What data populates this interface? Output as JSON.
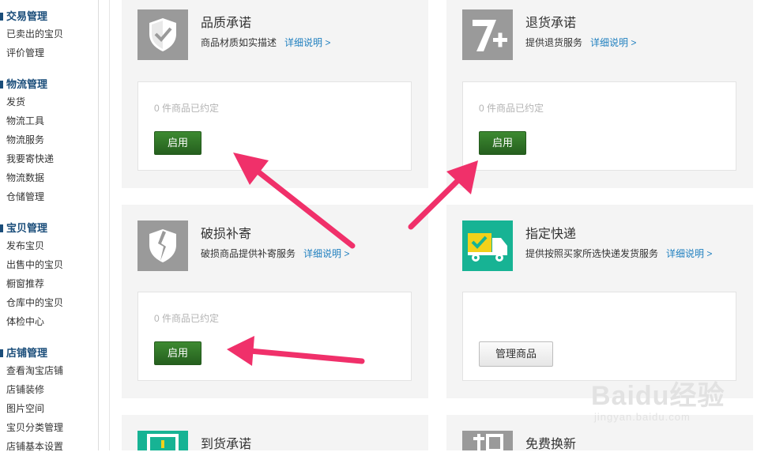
{
  "sidebar": {
    "groups": [
      {
        "title": "交易管理",
        "items": [
          "已卖出的宝贝",
          "评价管理"
        ]
      },
      {
        "title": "物流管理",
        "items": [
          "发货",
          "物流工具",
          "物流服务",
          "我要寄快递",
          "物流数据",
          "仓储管理"
        ]
      },
      {
        "title": "宝贝管理",
        "items": [
          "发布宝贝",
          "出售中的宝贝",
          "橱窗推荐",
          "仓库中的宝贝",
          "体检中心"
        ]
      },
      {
        "title": "店铺管理",
        "items": [
          "查看淘宝店铺",
          "店铺装修",
          "图片空间",
          "宝贝分类管理",
          "店铺基本设置"
        ]
      }
    ]
  },
  "cards": [
    {
      "title": "品质承诺",
      "desc": "商品材质如实描述",
      "link": "详细说明 >",
      "count": "0 件商品已约定",
      "button": "启用"
    },
    {
      "title": "退货承诺",
      "desc": "提供退货服务",
      "link": "详细说明 >",
      "count": "0 件商品已约定",
      "button": "启用"
    },
    {
      "title": "破损补寄",
      "desc": "破损商品提供补寄服务",
      "link": "详细说明 >",
      "count": "0 件商品已约定",
      "button": "启用"
    },
    {
      "title": "指定快递",
      "desc": "提供按照买家所选快递发货服务",
      "link": "详细说明 >",
      "button": "管理商品"
    },
    {
      "title": "到货承诺"
    },
    {
      "title": "免费换新"
    }
  ],
  "icons": {
    "quality": "shield-check-icon",
    "return": "seven-plus-icon",
    "damage": "broken-shield-icon",
    "courier": "truck-icon",
    "arrival": "clock-icon",
    "exchange": "swap-icon"
  },
  "colors": {
    "icon_gray": "#9a9a9a",
    "icon_teal": "#17b394",
    "button_green": "#2e7a27",
    "link_blue": "#1f7fbf",
    "arrow_pink": "#f0306a"
  },
  "watermark": {
    "brand": "Baidu经验",
    "url": "jingyan.baidu.com"
  }
}
